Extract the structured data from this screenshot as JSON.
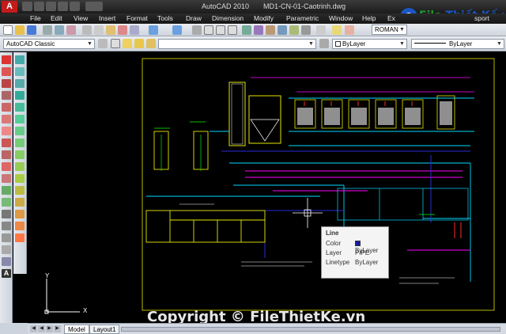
{
  "window": {
    "title": "AutoCAD 2010",
    "filename": "MD1-CN-01-Caotrinh.dwg"
  },
  "menu": [
    "File",
    "Edit",
    "View",
    "Insert",
    "Format",
    "Tools",
    "Draw",
    "Dimension",
    "Modify",
    "Parametric",
    "Window",
    "Help",
    "Ex",
    "sport"
  ],
  "toolbar": {
    "workspace": "AutoCAD Classic",
    "text_style": "ROMAN",
    "color_combo": "ByLayer",
    "linetype_combo": "ByLayer"
  },
  "tooltip": {
    "title": "Line",
    "rows": [
      {
        "key": "Color",
        "value": "ByLayer"
      },
      {
        "key": "Layer",
        "value": "PIPE"
      },
      {
        "key": "Linetype",
        "value": "ByLayer"
      }
    ]
  },
  "tabs": [
    {
      "label": "Model",
      "active": true
    },
    {
      "label": "Layout1",
      "active": false
    }
  ],
  "watermark": "Copyright © FileThietKe.vn",
  "logo": {
    "part1": "File ",
    "part2": "Thiết Kế",
    "suffix": ".vn"
  },
  "ucs": {
    "y": "Y",
    "x": "X"
  },
  "colors": {
    "line_cyan": "#00d8ff",
    "line_yellow": "#e6e600",
    "line_magenta": "#ff00ff",
    "line_blue": "#2a2ad8",
    "line_green": "#00c000",
    "line_red": "#ff2a2a",
    "line_white": "#ffffff"
  }
}
